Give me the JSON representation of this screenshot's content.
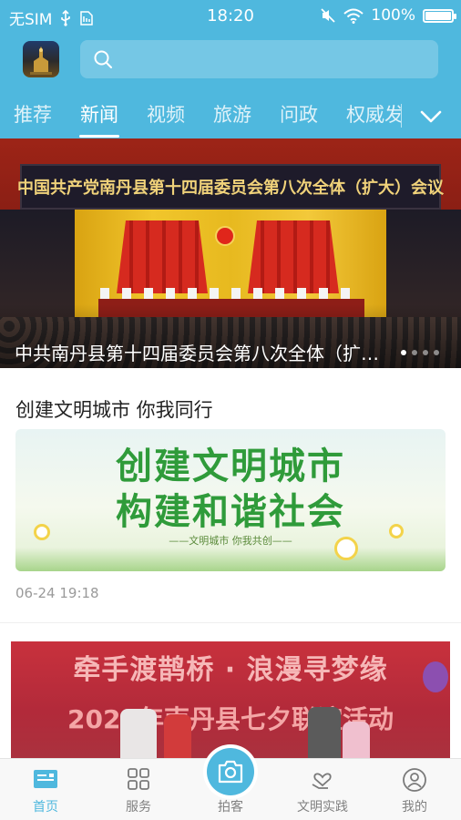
{
  "status_bar": {
    "carrier": "无SIM",
    "time": "18:20",
    "battery": "100%"
  },
  "search": {
    "placeholder": ""
  },
  "tabs": [
    {
      "label": "推荐"
    },
    {
      "label": "新闻",
      "active": true
    },
    {
      "label": "视频"
    },
    {
      "label": "旅游"
    },
    {
      "label": "问政"
    },
    {
      "label": "权威发"
    }
  ],
  "banner": {
    "stage_title": "中国共产党南丹县第十四届委员会第八次全体（扩大）会议",
    "caption": "中共南丹县第十四届委员会第八次全体（扩大）会议",
    "page_count": 4,
    "current_page": 1
  },
  "articles": [
    {
      "title": "创建文明城市 你我同行",
      "image_text_1": "创建文明城市",
      "image_text_2": "构建和谐社会",
      "image_sub": "——文明城市 你我共创——",
      "time": "06-24 19:18"
    },
    {
      "image_text_1": "牵手渡鹊桥 · 浪漫寻梦缘",
      "image_text_2": "2020年南丹县七夕联谊活动"
    }
  ],
  "bottom_nav": [
    {
      "label": "首页",
      "icon": "home-icon",
      "active": true
    },
    {
      "label": "服务",
      "icon": "grid-icon"
    },
    {
      "label": "拍客",
      "icon": "camera-icon"
    },
    {
      "label": "文明实践",
      "icon": "heart-hand-icon"
    },
    {
      "label": "我的",
      "icon": "user-icon"
    }
  ],
  "colors": {
    "brand": "#4fb8de",
    "active_nav": "#4fb8de",
    "inactive_nav": "#808080"
  }
}
